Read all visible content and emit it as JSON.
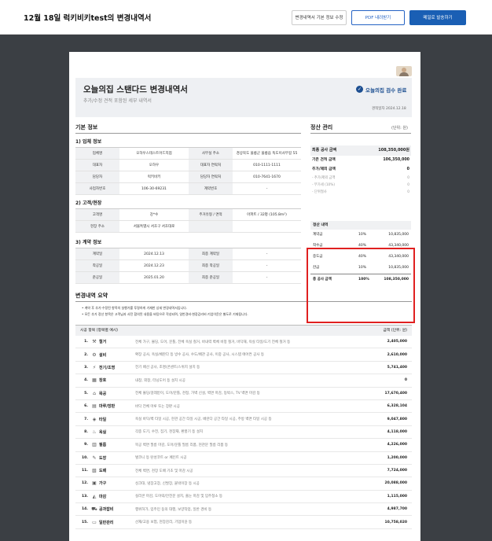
{
  "topbar": {
    "title": "12월 18일 럭키비키test의 변경내역서",
    "btn_edit": "변경내역서 기본 정보 수정",
    "btn_pdf": "PDF 내려받기",
    "btn_email": "메일로 발송하기"
  },
  "doc": {
    "title": "오늘의집 스탠다드 변경내역서",
    "subtitle": "추가/수정 견적 포함된 세부 내역서",
    "badge": "오늘의집 검수 완료",
    "date_label": "견적일자",
    "date": "2024.12.18"
  },
  "basic": {
    "heading": "기본 정보",
    "company_heading": "1) 업체 정보",
    "company": [
      [
        "업체명",
        "오하우스테스트어드지점",
        "사무실 주소",
        "경상북도 울릉군 울릉읍 독도이사무길 55"
      ],
      [
        "대표자",
        "오하우",
        "대표자 연락처",
        "010-1111-1111"
      ],
      [
        "담당자",
        "럭키비키",
        "담당자 연락처",
        "010-7641-1670"
      ],
      [
        "사업자번호",
        "106-30-69231",
        "계약번호",
        "-"
      ]
    ],
    "customer_heading": "2) 고객/현장",
    "customer": [
      [
        "고객명",
        "강*수",
        "주거유형 / 면적",
        "아파트 / 32평 (105.8m²)"
      ],
      [
        "현장 주소",
        "서울특별시 서초구 서초대로",
        "",
        ""
      ]
    ],
    "contract_heading": "3) 계약 정보",
    "contract": [
      [
        "계약일",
        "2024.12.13",
        "최종 계약일",
        "-"
      ],
      [
        "착공일",
        "2024.12.23",
        "최종 착공일",
        "-"
      ],
      [
        "준공일",
        "2025.01.20",
        "최종 준공일",
        "-"
      ]
    ]
  },
  "settlement": {
    "heading": "정산 관리",
    "unit": "(단위: 원)",
    "final_label": "최종 공사 금액",
    "final_value": "108,350,000원",
    "base_label": "기존 견적 금액",
    "base_value": "106,350,000",
    "addmod_label": "추가/제외 금액",
    "addmod_value": "0",
    "sub_rows": [
      [
        "- 추가/제외 금액",
        "0"
      ],
      [
        "- 부가세 (10%)",
        "0"
      ],
      [
        "- 단위절사",
        "0"
      ]
    ]
  },
  "payment": {
    "heading": "정산 내역",
    "rows": [
      [
        "계약금",
        "10%",
        "10,835,000"
      ],
      [
        "착수금",
        "40%",
        "43,340,000"
      ],
      [
        "중도금",
        "40%",
        "43,340,000"
      ],
      [
        "잔금",
        "10%",
        "10,835,000"
      ]
    ],
    "total": [
      "총 공사 금액",
      "100%",
      "108,350,000"
    ]
  },
  "summary": {
    "heading": "변경내역 요약",
    "notes": [
      "• 계약 후 추가·수정된 항목의 실행가를 투명하게 기재한 상세 변경내역서입니다.",
      "• 모든 추가 정산 항목은 고객님과 사전 합의된 내용을 바탕으로 작성되며, 일반경비·현장감리비·기업이윤은 별도로 기재됩니다."
    ],
    "col_left": "시공 항목 (항목별 예시)",
    "col_right": "금액 (단위: 원)",
    "items": [
      {
        "no": "1.",
        "icon": "hammer-icon",
        "glyph": "⚒",
        "name": "철거",
        "desc": "전체 가구, 몰딩, 도어, 문틀, 전체 욕실 철거, 바내력 벽체 비정 철거, 바닥재, 욕실 타일/도기 전체 철거 등",
        "amount": "2,405,000"
      },
      {
        "no": "2.",
        "icon": "pipe-icon",
        "glyph": "⚙",
        "name": "설비",
        "desc": "확장 공사, 욕실/베란다 등 방수 공사, 수도/배관 공사, 이중 공사, 시스템 에어컨 공사 등",
        "amount": "2,610,000"
      },
      {
        "no": "3.",
        "icon": "plug-icon",
        "glyph": "⚡",
        "name": "전기/조명",
        "desc": "전기 배선 공사, 조명(콘센트/스위치 설치 등",
        "amount": "5,741,400"
      },
      {
        "no": "4.",
        "icon": "window-icon",
        "glyph": "▦",
        "name": "창호",
        "desc": "내창, 외창, 터닝도어 등 설치 시공",
        "amount": "0"
      },
      {
        "no": "5.",
        "icon": "saw-icon",
        "glyph": "⌂",
        "name": "목공",
        "desc": "전체 몰딩/걸레받이, 도어/문틀, 천정, 가벽 신설, 벽면 마감, 등박스, TV 벽면 마감 등",
        "amount": "17,670,400"
      },
      {
        "no": "6.",
        "icon": "floor-icon",
        "glyph": "▤",
        "name": "마루/장판",
        "desc": "바닥 전체 마루 또는 장판 시공",
        "amount": "6,328,104"
      },
      {
        "no": "7.",
        "icon": "tile-icon",
        "glyph": "◈",
        "name": "타일",
        "desc": "욕실 바닥/벽 타일 시공, 현관 공간 타일 시공, 베란다 공간 타일 시공, 주방 벽면 타일 시공 등",
        "amount": "9,047,800"
      },
      {
        "no": "8.",
        "icon": "bathtub-icon",
        "glyph": "♨",
        "name": "욕실",
        "desc": "각종 도기, 수전, 집기, 천장재, 환풍기 등 설치",
        "amount": "4,118,000"
      },
      {
        "no": "9.",
        "icon": "roller-icon",
        "glyph": "▥",
        "name": "필름",
        "desc": "목공 벽면 필름 마감, 도어/문틀 필름 리폼, 현관문 필름 리폼 등",
        "amount": "4,226,000"
      },
      {
        "no": "10.",
        "icon": "spray-icon",
        "glyph": "✎",
        "name": "도장",
        "desc": "벌코니 등 탄성코트 or 페인트 시공",
        "amount": "1,200,000"
      },
      {
        "no": "11.",
        "icon": "wallpaper-icon",
        "glyph": "▧",
        "name": "도배",
        "desc": "전체 벽면, 천장 도배 기초 및 마감 시공",
        "amount": "7,724,000"
      },
      {
        "no": "12.",
        "icon": "cabinet-icon",
        "glyph": "▣",
        "name": "가구",
        "desc": "싱크대, 냉장고장, 신발장, 붙박이장 등 시공",
        "amount": "20,088,000"
      },
      {
        "no": "13.",
        "icon": "trowel-icon",
        "glyph": "◭",
        "name": "마감",
        "desc": "실리콘 마감, 도어락/안전문 설치, 줄눈 마감 및 입주청소 등",
        "amount": "1,115,000"
      },
      {
        "no": "14.",
        "icon": "truck-icon",
        "glyph": "⛟",
        "name": "공과잡비",
        "desc": "행위허가, 입주민 동의 대행, 보양작업, 일반 경비 등",
        "amount": "4,987,700"
      },
      {
        "no": "15.",
        "icon": "document-icon",
        "glyph": "▭",
        "name": "일반관리",
        "desc": "산재/고용 보험, 현장감리, 기업이윤 등",
        "amount": "10,758,020"
      }
    ]
  }
}
